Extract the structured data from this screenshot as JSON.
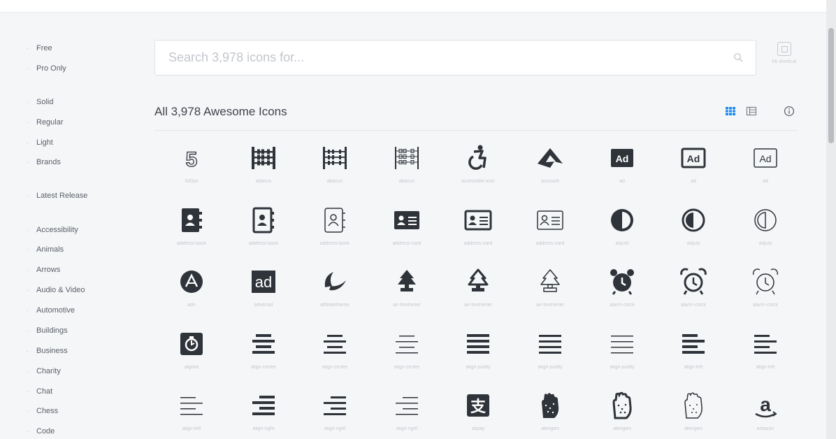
{
  "sidebar": {
    "items": [
      {
        "label": "Free"
      },
      {
        "label": "Pro Only"
      },
      {
        "label": "Solid"
      },
      {
        "label": "Regular"
      },
      {
        "label": "Light"
      },
      {
        "label": "Brands"
      },
      {
        "label": "Latest Release"
      },
      {
        "label": "Accessibility"
      },
      {
        "label": "Animals"
      },
      {
        "label": "Arrows"
      },
      {
        "label": "Audio & Video"
      },
      {
        "label": "Automotive"
      },
      {
        "label": "Buildings"
      },
      {
        "label": "Business"
      },
      {
        "label": "Charity"
      },
      {
        "label": "Chat"
      },
      {
        "label": "Chess"
      },
      {
        "label": "Code"
      }
    ]
  },
  "search": {
    "placeholder": "Search 3,978 icons for...",
    "value": "",
    "shortcut_label": "kb shortcut"
  },
  "main": {
    "title": "All 3,978 Awesome Icons",
    "active_view": "grid",
    "accent_color": "#1c88ed"
  },
  "icons": [
    {
      "name": "500px",
      "icon": "500px"
    },
    {
      "name": "abacus",
      "icon": "abacus-solid"
    },
    {
      "name": "abacus",
      "icon": "abacus-regular"
    },
    {
      "name": "abacus",
      "icon": "abacus-light"
    },
    {
      "name": "accessible-icon",
      "icon": "accessible-icon"
    },
    {
      "name": "accusoft",
      "icon": "accusoft"
    },
    {
      "name": "ad",
      "icon": "ad-solid"
    },
    {
      "name": "ad",
      "icon": "ad-regular"
    },
    {
      "name": "ad",
      "icon": "ad-light"
    },
    {
      "name": "address-book",
      "icon": "address-book-solid"
    },
    {
      "name": "address-book",
      "icon": "address-book-regular"
    },
    {
      "name": "address-book",
      "icon": "address-book-light"
    },
    {
      "name": "address-card",
      "icon": "address-card-solid"
    },
    {
      "name": "address-card",
      "icon": "address-card-regular"
    },
    {
      "name": "address-card",
      "icon": "address-card-light"
    },
    {
      "name": "adjust",
      "icon": "adjust-solid"
    },
    {
      "name": "adjust",
      "icon": "adjust-regular"
    },
    {
      "name": "adjust",
      "icon": "adjust-light"
    },
    {
      "name": "adn",
      "icon": "adn"
    },
    {
      "name": "adversal",
      "icon": "adversal"
    },
    {
      "name": "affiliatetheme",
      "icon": "affiliatetheme"
    },
    {
      "name": "air-freshener",
      "icon": "air-freshener-solid"
    },
    {
      "name": "air-freshener",
      "icon": "air-freshener-regular"
    },
    {
      "name": "air-freshener",
      "icon": "air-freshener-light"
    },
    {
      "name": "alarm-clock",
      "icon": "alarm-clock-solid"
    },
    {
      "name": "alarm-clock",
      "icon": "alarm-clock-regular"
    },
    {
      "name": "alarm-clock",
      "icon": "alarm-clock-light"
    },
    {
      "name": "algolia",
      "icon": "algolia"
    },
    {
      "name": "align-center",
      "icon": "align-center-solid"
    },
    {
      "name": "align-center",
      "icon": "align-center-regular"
    },
    {
      "name": "align-center",
      "icon": "align-center-light"
    },
    {
      "name": "align-justify",
      "icon": "align-justify-solid"
    },
    {
      "name": "align-justify",
      "icon": "align-justify-regular"
    },
    {
      "name": "align-justify",
      "icon": "align-justify-light"
    },
    {
      "name": "align-left",
      "icon": "align-left-solid"
    },
    {
      "name": "align-left",
      "icon": "align-left-regular"
    },
    {
      "name": "align-left",
      "icon": "align-left-light"
    },
    {
      "name": "align-right",
      "icon": "align-right-solid"
    },
    {
      "name": "align-right",
      "icon": "align-right-regular"
    },
    {
      "name": "align-right",
      "icon": "align-right-light"
    },
    {
      "name": "alipay",
      "icon": "alipay"
    },
    {
      "name": "allergies",
      "icon": "allergies-solid"
    },
    {
      "name": "allergies",
      "icon": "allergies-regular"
    },
    {
      "name": "allergies",
      "icon": "allergies-light"
    },
    {
      "name": "amazon",
      "icon": "amazon"
    }
  ]
}
